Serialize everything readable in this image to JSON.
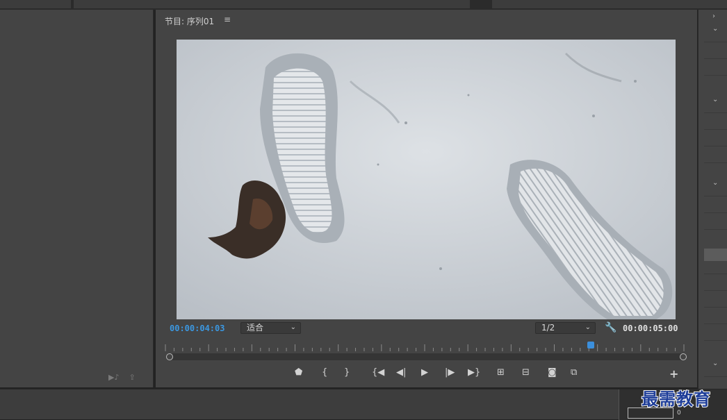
{
  "program_monitor": {
    "title": "节目: 序列01",
    "menu_icon": "menu-icon",
    "current_timecode": "00:00:04:03",
    "fit_select": "适合",
    "resolution_select": "1/2",
    "duration_timecode": "00:00:05:00",
    "playhead_position": 0.82,
    "settings_icon": "wrench-icon"
  },
  "transport": {
    "buttons": [
      {
        "name": "add-marker",
        "icon": "marker-icon"
      },
      {
        "name": "mark-in",
        "icon": "mark-in-icon"
      },
      {
        "name": "mark-out",
        "icon": "mark-out-icon"
      },
      {
        "name": "go-to-in",
        "icon": "go-to-in-icon"
      },
      {
        "name": "step-back",
        "icon": "step-back-icon"
      },
      {
        "name": "play",
        "icon": "play-icon"
      },
      {
        "name": "step-forward",
        "icon": "step-forward-icon"
      },
      {
        "name": "go-to-out",
        "icon": "go-to-out-icon"
      },
      {
        "name": "lift",
        "icon": "lift-icon"
      },
      {
        "name": "extract",
        "icon": "extract-icon"
      },
      {
        "name": "export-frame",
        "icon": "camera-icon"
      },
      {
        "name": "compare-view",
        "icon": "compare-icon"
      },
      {
        "name": "button-editor",
        "icon": "plus-icon"
      }
    ]
  },
  "meter": {
    "label": "0"
  },
  "watermark": {
    "text": "最需教育"
  },
  "colors": {
    "accent": "#3b97e0",
    "panel": "#444444",
    "watermark": "#1f3e99"
  }
}
